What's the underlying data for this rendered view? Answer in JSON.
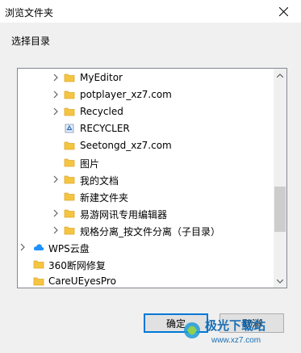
{
  "window": {
    "title": "浏览文件夹"
  },
  "instruction": "选择目录",
  "tree": {
    "items": [
      {
        "label": "MyEditor",
        "icon": "folder-icon",
        "expandable": true
      },
      {
        "label": "potplayer_xz7.com",
        "icon": "folder-icon",
        "expandable": true
      },
      {
        "label": "Recycled",
        "icon": "folder-icon",
        "expandable": true
      },
      {
        "label": "RECYCLER",
        "icon": "recycle-folder-icon",
        "expandable": false
      },
      {
        "label": "Seetongd_xz7.com",
        "icon": "folder-icon",
        "expandable": false
      },
      {
        "label": "图片",
        "icon": "folder-icon",
        "expandable": false,
        "selected": true
      },
      {
        "label": "我的文档",
        "icon": "folder-icon",
        "expandable": true
      },
      {
        "label": "新建文件夹",
        "icon": "folder-icon",
        "expandable": false
      },
      {
        "label": "易游网讯专用编辑器",
        "icon": "folder-icon",
        "expandable": true
      },
      {
        "label": "规格分离_按文件分离（子目录）",
        "icon": "folder-icon",
        "expandable": true
      },
      {
        "label": "WPS云盘",
        "icon": "cloud-icon",
        "expandable": true
      },
      {
        "label": "360断网修复",
        "icon": "folder-icon",
        "expandable": false
      },
      {
        "label": "CareUEyesPro",
        "icon": "folder-icon",
        "expandable": false
      }
    ]
  },
  "buttons": {
    "ok": "确定",
    "cancel": "取消"
  },
  "watermark": {
    "text": "极光下载站",
    "url": "www.xz7.com"
  },
  "colors": {
    "folder": "#f5c542",
    "folder_dark": "#e0a82e",
    "accent": "#0078d7",
    "cloud": "#1e90ff"
  }
}
